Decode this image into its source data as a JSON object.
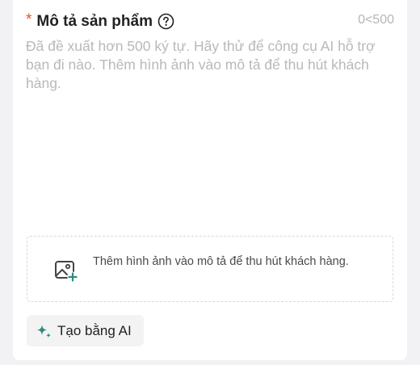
{
  "section": {
    "required_mark": "*",
    "title": "Mô tả sản phẩm",
    "help_icon": "question-circle-icon",
    "counter": "0<500"
  },
  "description": {
    "placeholder": "Đã đề xuất hơn 500 ký tự. Hãy thử để công cụ AI hỗ trợ bạn đi nào. Thêm hình ảnh vào mô tả để thu hút khách hàng.",
    "value": ""
  },
  "image_upload": {
    "icon": "image-add-icon",
    "text": "Thêm hình ảnh vào mô tả để thu hút khách hàng."
  },
  "ai_button": {
    "icon": "sparkle-icon",
    "label": "Tạo bằng AI",
    "icon_color": "#2e8b80"
  },
  "colors": {
    "required": "#ee4d2d",
    "placeholder": "#b9b9b9",
    "counter": "#b5b5b5"
  }
}
